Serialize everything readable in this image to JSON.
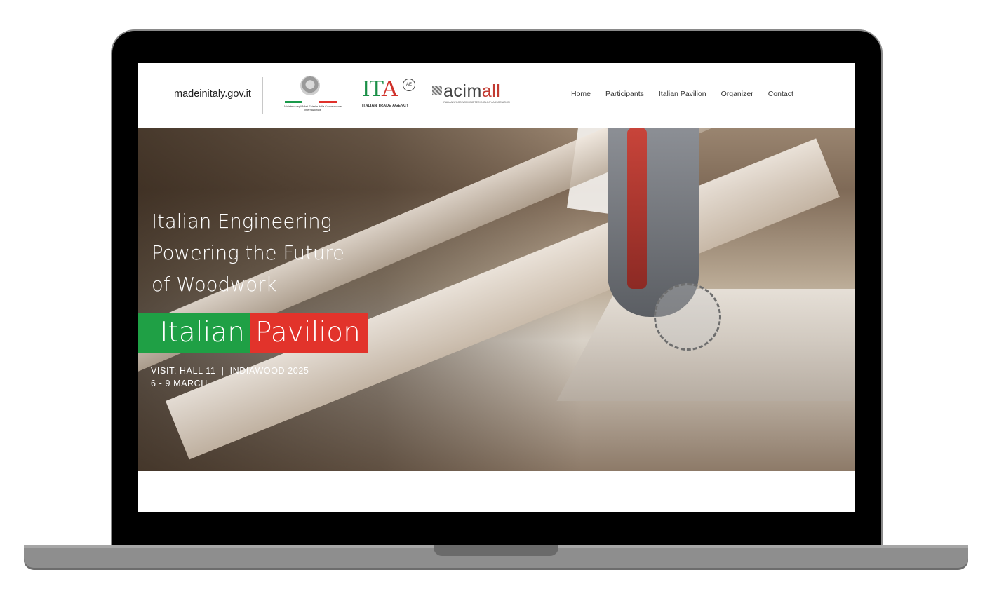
{
  "header": {
    "site_link": "madeinitaly.gov.it",
    "ministry_logo_text": "Ministero degli Affari Esteri e della Cooperazione Internazionale",
    "ita_logo": {
      "letters": [
        "I",
        "T",
        "A"
      ],
      "badge": "AE",
      "caption": "ITALIAN TRADE AGENCY"
    },
    "acimall_logo": {
      "word_part1": "acim",
      "word_part2": "all",
      "caption": "ITALIAN WOODWORKING TECHNOLOGY ASSOCIATION"
    },
    "nav": [
      {
        "label": "Home"
      },
      {
        "label": "Participants"
      },
      {
        "label": "Italian Pavilion"
      },
      {
        "label": "Organizer"
      },
      {
        "label": "Contact"
      }
    ]
  },
  "hero": {
    "title_lines": [
      "Italian Engineering",
      "Powering the Future",
      "of Woodwork"
    ],
    "pavilion_word1": "Italian",
    "pavilion_word2": "Pavilion",
    "visit_line1": "VISIT: HALL 11  |  INDIAWOOD 2025",
    "visit_line2": "6 - 9 MARCH"
  },
  "colors": {
    "italy_green": "#1fa045",
    "italy_red": "#e2332b",
    "laptop_bezel": "#000000",
    "laptop_base": "#8e8e8e"
  }
}
